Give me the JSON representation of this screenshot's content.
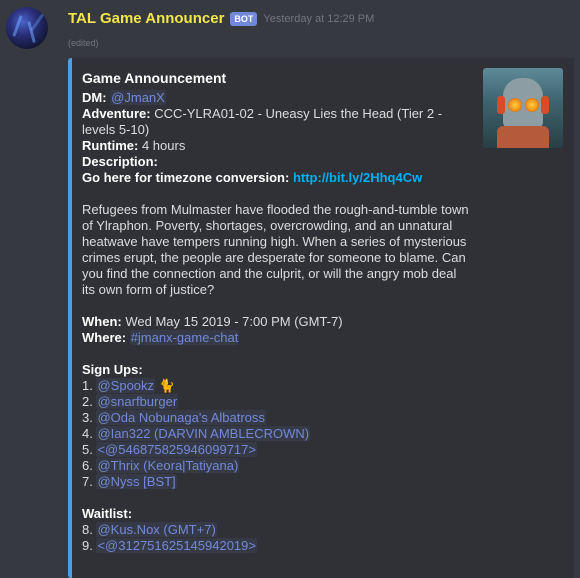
{
  "message": {
    "username": "TAL Game Announcer",
    "bot_tag": "BOT",
    "timestamp": "Yesterday at 12:29 PM",
    "edited": "(edited)"
  },
  "embed": {
    "accent_color": "#4f9ee3",
    "title": "Game Announcement",
    "dm_label": "DM:",
    "dm_value": "@JmanX",
    "adventure_label": "Adventure:",
    "adventure_value": "CCC-YLRA01-02 - Uneasy Lies the Head (Tier 2 - levels 5-10)",
    "runtime_label": "Runtime:",
    "runtime_value": "4 hours",
    "description_label": "Description:",
    "timezone_label": "Go here for timezone conversion:",
    "timezone_link": "http://bit.ly/2Hhq4Cw",
    "description": "Refugees from Mulmaster have flooded the rough-and-tumble town of Ylraphon. Poverty, shortages, overcrowding, and an unnatural heatwave have tempers running high. When a series of mysterious crimes erupt, the people are desperate for someone to blame. Can you find the connection and the culprit, or will the angry mob deal its own form of justice?",
    "when_label": "When:",
    "when_value": "Wed May 15 2019 - 7:00 PM (GMT-7)",
    "where_label": "Where:",
    "where_value": "#jmanx-game-chat",
    "signups_label": "Sign Ups:",
    "signups": [
      {
        "num": "1.",
        "name": "@Spookz",
        "emoji": "🐈"
      },
      {
        "num": "2.",
        "name": "@snarfburger",
        "emoji": ""
      },
      {
        "num": "3.",
        "name": "@Oda Nobunaga's Albatross",
        "emoji": ""
      },
      {
        "num": "4.",
        "name": "@Ian322 (DARVIN AMBLECROWN)",
        "emoji": ""
      },
      {
        "num": "5.",
        "name": "<@546875825946099717>",
        "emoji": ""
      },
      {
        "num": "6.",
        "name": "@Thrix (Keora|Tatiyana)",
        "emoji": ""
      },
      {
        "num": "7.",
        "name": "@Nyss [BST]",
        "emoji": ""
      }
    ],
    "waitlist_label": "Waitlist:",
    "waitlist": [
      {
        "num": "8.",
        "name": "@Kus.Nox (GMT+7)"
      },
      {
        "num": "9.",
        "name": "<@312751625145942019>"
      }
    ]
  }
}
